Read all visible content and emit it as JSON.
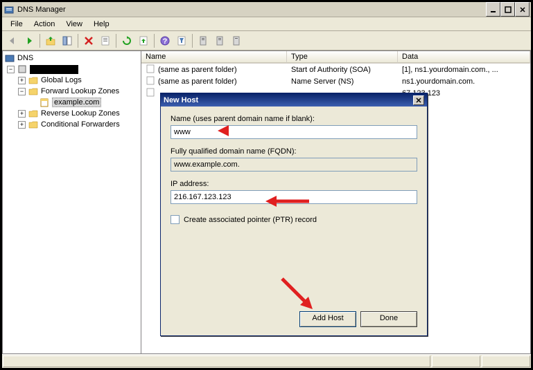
{
  "window": {
    "title": "DNS Manager"
  },
  "menu": {
    "file": "File",
    "action": "Action",
    "view": "View",
    "help": "Help"
  },
  "tree": {
    "root": "DNS",
    "server": "",
    "global_logs": "Global Logs",
    "flz": "Forward Lookup Zones",
    "example": "example.com",
    "rlz": "Reverse Lookup Zones",
    "cf": "Conditional Forwarders"
  },
  "columns": {
    "name": "Name",
    "type": "Type",
    "data": "Data"
  },
  "rows": [
    {
      "name": "(same as parent folder)",
      "type": "Start of Authority (SOA)",
      "data": "[1], ns1.yourdomain.com., ..."
    },
    {
      "name": "(same as parent folder)",
      "type": "Name Server (NS)",
      "data": "ns1.yourdomain.com."
    },
    {
      "name": "",
      "type": "",
      "data": "67.123.123"
    }
  ],
  "dialog": {
    "title": "New Host",
    "name_label": "Name (uses parent domain name if blank):",
    "name_value": "www",
    "fqdn_label": "Fully qualified domain name (FQDN):",
    "fqdn_value": "www.example.com.",
    "ip_label": "IP address:",
    "ip_value": "216.167.123.123",
    "ptr_label": "Create associated pointer (PTR) record",
    "add_btn": "Add Host",
    "done_btn": "Done"
  }
}
